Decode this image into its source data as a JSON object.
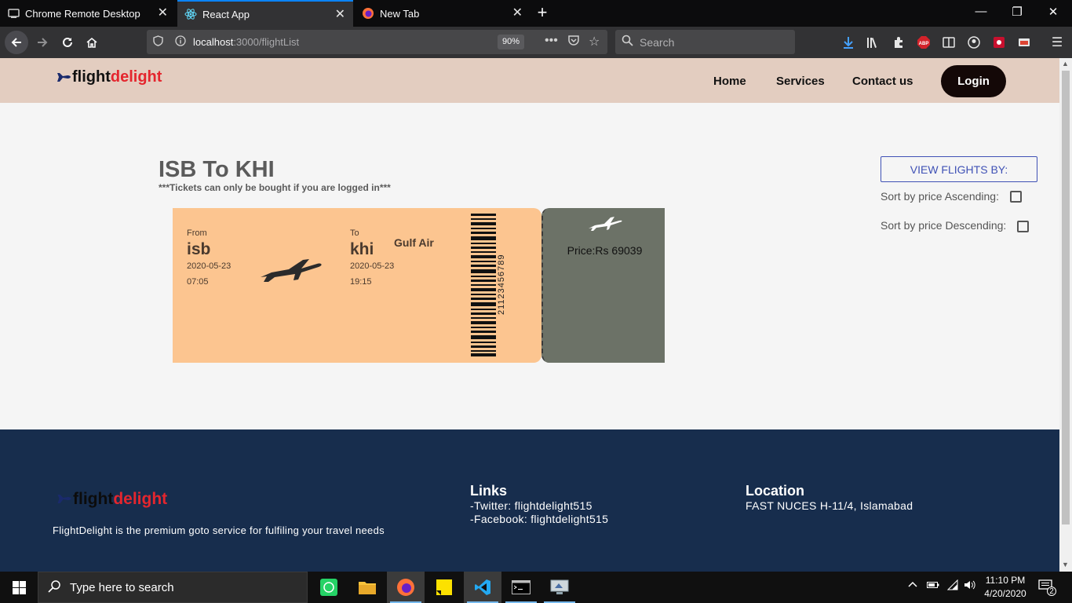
{
  "browser": {
    "tabs": [
      {
        "title": "Chrome Remote Desktop"
      },
      {
        "title": "React App"
      },
      {
        "title": "New Tab"
      }
    ],
    "url_host": "localhost",
    "url_path": ":3000/flightList",
    "zoom": "90%",
    "search_placeholder": "Search"
  },
  "site": {
    "logo_part1": "flight",
    "logo_part2": "delight",
    "nav": {
      "home": "Home",
      "services": "Services",
      "contact": "Contact us",
      "login": "Login"
    },
    "accent_color": "#e4262e"
  },
  "main": {
    "route_title": "ISB To KHI",
    "login_note": "***Tickets can only be bought if you are logged in***",
    "view_by_label": "VIEW FLIGHTS BY:",
    "sort_asc_label": "Sort by price Ascending:",
    "sort_desc_label": "Sort by price Descending:",
    "ticket": {
      "from_label": "From",
      "from_code": "isb",
      "from_date": "2020-05-23",
      "from_time": "07:05",
      "to_label": "To",
      "to_code": "khi",
      "to_date": "2020-05-23",
      "to_time": "19:15",
      "airline": "Gulf Air",
      "barcode_number": "21123456789",
      "price": "Price:Rs 69039"
    }
  },
  "footer": {
    "logo_part1": "flight",
    "logo_part2": "delight",
    "tagline": "FlightDelight is the premium goto service for fulfiling your travel needs",
    "links_heading": "Links",
    "twitter": "-Twitter: flightdelight515",
    "facebook": "-Facebook: flightdelight515",
    "location_heading": "Location",
    "address": "FAST NUCES H-11/4, Islamabad"
  },
  "taskbar": {
    "search_placeholder": "Type here to search",
    "time": "11:10 PM",
    "date": "4/20/2020",
    "notification_count": "2"
  }
}
